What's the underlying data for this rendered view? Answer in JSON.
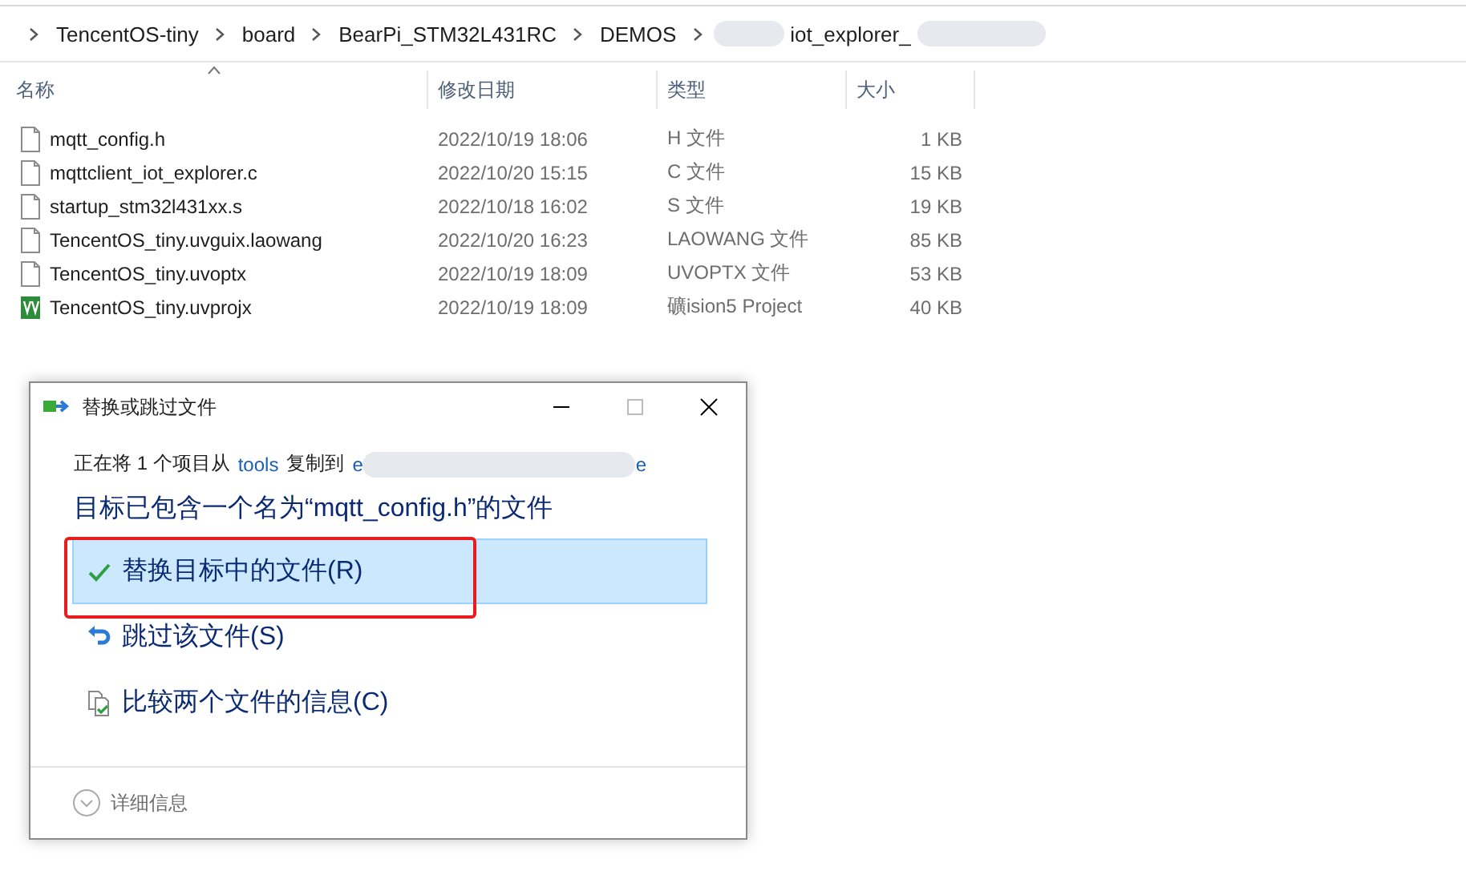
{
  "breadcrumb": [
    {
      "label": "TencentOS-tiny"
    },
    {
      "label": "board"
    },
    {
      "label": "BearPi_STM32L431RC"
    },
    {
      "label": "DEMOS"
    },
    {
      "label": "iot_explorer_",
      "redacted_before": true,
      "redacted_after": true
    }
  ],
  "table": {
    "columns": [
      {
        "label": "名称",
        "sorted": true
      },
      {
        "label": "修改日期"
      },
      {
        "label": "类型"
      },
      {
        "label": "大小"
      }
    ],
    "rows": [
      {
        "name": "mqtt_config.h",
        "date": "2022/10/19 18:06",
        "type": "H 文件",
        "size": "1 KB",
        "kind": "file"
      },
      {
        "name": "mqttclient_iot_explorer.c",
        "date": "2022/10/20 15:15",
        "type": "C 文件",
        "size": "15 KB",
        "kind": "file"
      },
      {
        "name": "startup_stm32l431xx.s",
        "date": "2022/10/18 16:02",
        "type": "S 文件",
        "size": "19 KB",
        "kind": "file"
      },
      {
        "name": "TencentOS_tiny.uvguix.laowang",
        "date": "2022/10/20 16:23",
        "type": "LAOWANG 文件",
        "size": "85 KB",
        "kind": "file"
      },
      {
        "name": "TencentOS_tiny.uvoptx",
        "date": "2022/10/19 18:09",
        "type": "UVOPTX 文件",
        "size": "53 KB",
        "kind": "file"
      },
      {
        "name": "TencentOS_tiny.uvprojx",
        "date": "2022/10/19 18:09",
        "type": "礦ision5 Project",
        "size": "40 KB",
        "kind": "project"
      }
    ]
  },
  "dialog": {
    "title": "替换或跳过文件",
    "copy_line": {
      "before": "正在将 1 个项目从",
      "source": "tools",
      "middle": "复制到",
      "dest_start": "e",
      "dest_end": "e"
    },
    "heading": "目标已包含一个名为“mqtt_config.h”的文件",
    "options": [
      {
        "label": "替换目标中的文件(R)",
        "kind": "replace",
        "selected": true,
        "highlighted": true
      },
      {
        "label": "跳过该文件(S)",
        "kind": "skip",
        "selected": false,
        "highlighted": false
      },
      {
        "label": "比较两个文件的信息(C)",
        "kind": "compare",
        "selected": false,
        "highlighted": false
      }
    ],
    "details": "详细信息"
  }
}
